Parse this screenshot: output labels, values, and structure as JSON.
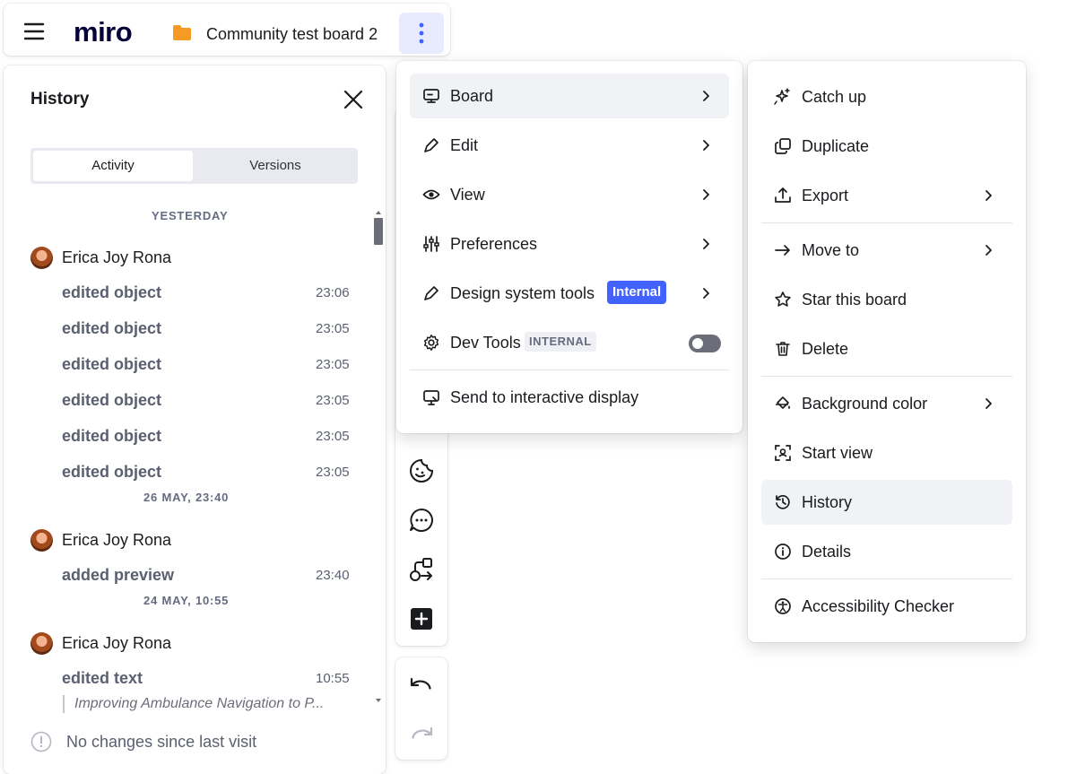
{
  "app": {
    "logo": "miro",
    "board_title": "Community test board 2"
  },
  "history": {
    "title": "History",
    "tabs": [
      {
        "label": "Activity",
        "active": true
      },
      {
        "label": "Versions",
        "active": false
      }
    ],
    "groups": [
      {
        "date": "YESTERDAY",
        "user": "Erica Joy Rona",
        "entries": [
          {
            "text": "edited object",
            "time": "23:06"
          },
          {
            "text": "edited object",
            "time": "23:05"
          },
          {
            "text": "edited object",
            "time": "23:05"
          },
          {
            "text": "edited object",
            "time": "23:05"
          },
          {
            "text": "edited object",
            "time": "23:05"
          },
          {
            "text": "edited object",
            "time": "23:05"
          }
        ]
      },
      {
        "date": "26 MAY, 23:40",
        "user": "Erica Joy Rona",
        "entries": [
          {
            "text": "added preview",
            "time": "23:40"
          }
        ]
      },
      {
        "date": "24 MAY, 10:55",
        "user": "Erica Joy Rona",
        "entries": [
          {
            "text": "edited text",
            "time": "10:55",
            "quote": "Improving Ambulance Navigation to P..."
          }
        ]
      }
    ],
    "footer": "No changes since last visit"
  },
  "board_menu": {
    "items": [
      {
        "label": "Board",
        "icon": "board-icon",
        "submenu": true,
        "active": true
      },
      {
        "label": "Edit",
        "icon": "pen-icon",
        "submenu": true
      },
      {
        "label": "View",
        "icon": "eye-icon",
        "submenu": true
      },
      {
        "label": "Preferences",
        "icon": "sliders-icon",
        "submenu": true
      },
      {
        "label": "Design system tools",
        "icon": "pen-icon",
        "submenu": true,
        "badge": "Internal"
      },
      {
        "label": "Dev Tools",
        "icon": "gear-icon",
        "badge": "INTERNAL",
        "toggle": false
      },
      {
        "label": "Send to interactive display",
        "icon": "display-icon"
      }
    ]
  },
  "board_submenu": {
    "items": [
      {
        "label": "Catch up",
        "icon": "sparkle-icon"
      },
      {
        "label": "Duplicate",
        "icon": "duplicate-icon"
      },
      {
        "label": "Export",
        "icon": "export-icon",
        "submenu": true
      },
      {
        "label": "Move to",
        "icon": "arrow-right-icon",
        "submenu": true
      },
      {
        "label": "Star this board",
        "icon": "star-icon"
      },
      {
        "label": "Delete",
        "icon": "trash-icon"
      },
      {
        "label": "Background color",
        "icon": "paint-bucket-icon",
        "submenu": true
      },
      {
        "label": "Start view",
        "icon": "frame-icon"
      },
      {
        "label": "History",
        "icon": "history-icon",
        "active": true
      },
      {
        "label": "Details",
        "icon": "info-icon"
      },
      {
        "label": "Accessibility Checker",
        "icon": "accessibility-icon"
      }
    ]
  },
  "colors": {
    "accent": "#4262ff",
    "active_bg": "#f1f2f5",
    "more_button_bg": "#e8ebfd",
    "folder": "#f59a23"
  }
}
